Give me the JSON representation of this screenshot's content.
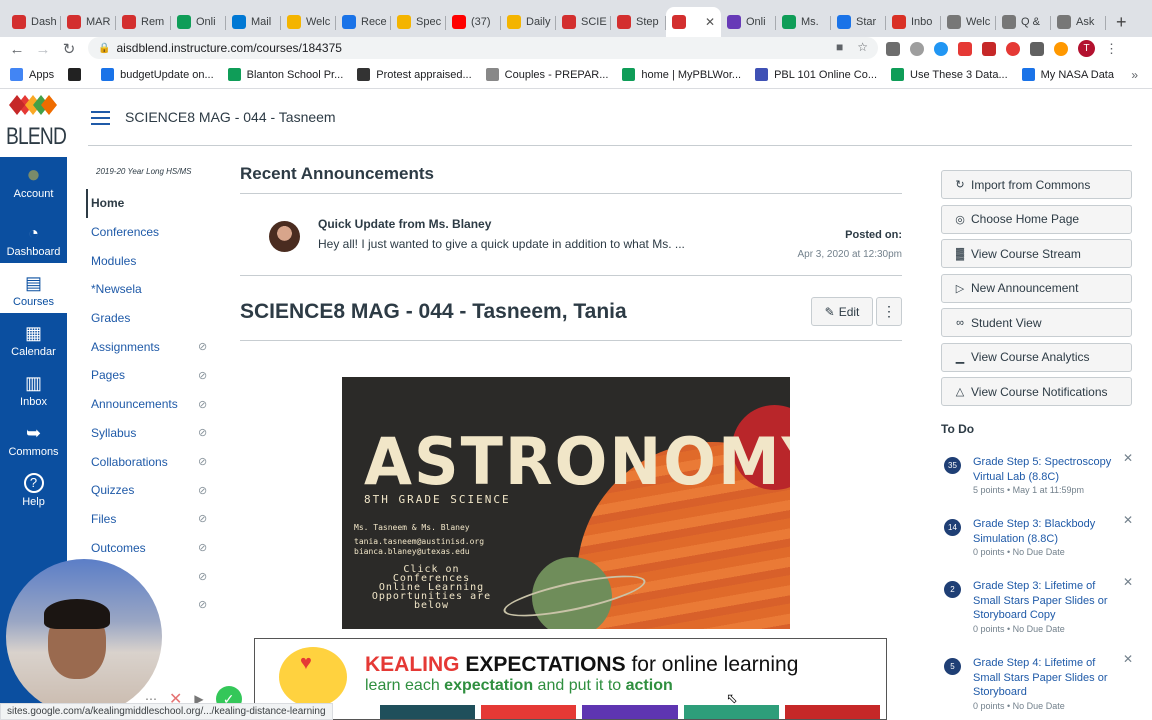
{
  "browser": {
    "tabs": [
      {
        "label": "Dash",
        "color": "#d32f2f"
      },
      {
        "label": "MAR",
        "color": "#d32f2f"
      },
      {
        "label": "Rem",
        "color": "#d32f2f"
      },
      {
        "label": "Onli",
        "color": "#0f9d58"
      },
      {
        "label": "Mail",
        "color": "#0078d4"
      },
      {
        "label": "Welc",
        "color": "#f4b400"
      },
      {
        "label": "Rece",
        "color": "#1a73e8"
      },
      {
        "label": "Spec",
        "color": "#f4b400"
      },
      {
        "label": "(37)",
        "color": "#ff0000"
      },
      {
        "label": "Daily",
        "color": "#f4b400"
      },
      {
        "label": "SCIE",
        "color": "#d32f2f"
      },
      {
        "label": "Step",
        "color": "#d32f2f"
      },
      {
        "label": "",
        "color": "#d32f2f",
        "active": true
      },
      {
        "label": "Onli",
        "color": "#673ab7"
      },
      {
        "label": "Ms.",
        "color": "#0f9d58"
      },
      {
        "label": "Star",
        "color": "#1a73e8"
      },
      {
        "label": "Inbo",
        "color": "#d93025"
      },
      {
        "label": "Welc",
        "color": "#777777"
      },
      {
        "label": "Q &",
        "color": "#777777"
      },
      {
        "label": "Ask",
        "color": "#777777"
      }
    ],
    "url": "aisdblend.instructure.com/courses/184375",
    "profile_initial": "T",
    "bookmarks": [
      {
        "label": "Apps",
        "color": "#4285f4"
      },
      {
        "label": "",
        "color": "#222222"
      },
      {
        "label": "budgetUpdate on...",
        "color": "#1a73e8"
      },
      {
        "label": "Blanton School Pr...",
        "color": "#0f9d58"
      },
      {
        "label": "Protest appraised...",
        "color": "#333333"
      },
      {
        "label": "Couples - PREPAR...",
        "color": "#888888"
      },
      {
        "label": "home | MyPBLWor...",
        "color": "#0f9d58"
      },
      {
        "label": "PBL 101 Online Co...",
        "color": "#3f51b5"
      },
      {
        "label": "Use These 3 Data...",
        "color": "#0f9d58"
      },
      {
        "label": "My NASA Data",
        "color": "#1a73e8"
      }
    ]
  },
  "global_nav": {
    "logo_text": "BLEND",
    "items": [
      {
        "label": "Account",
        "icon": "avatar"
      },
      {
        "label": "Dashboard",
        "icon": "dashboard-icon"
      },
      {
        "label": "Courses",
        "icon": "courses-icon",
        "active": true
      },
      {
        "label": "Calendar",
        "icon": "calendar-icon"
      },
      {
        "label": "Inbox",
        "icon": "inbox-icon"
      },
      {
        "label": "Commons",
        "icon": "commons-icon"
      },
      {
        "label": "Help",
        "icon": "help-icon"
      }
    ]
  },
  "header": {
    "breadcrumb": "SCIENCE8 MAG - 044 - Tasneem"
  },
  "course_nav": {
    "term": "2019-20 Year Long HS/MS",
    "items": [
      {
        "label": "Home",
        "active": true,
        "hidden": false
      },
      {
        "label": "Conferences",
        "hidden": false
      },
      {
        "label": "Modules",
        "hidden": false
      },
      {
        "label": "*Newsela",
        "hidden": false
      },
      {
        "label": "Grades",
        "hidden": false
      },
      {
        "label": "Assignments",
        "hidden": true
      },
      {
        "label": "Pages",
        "hidden": true
      },
      {
        "label": "Announcements",
        "hidden": true
      },
      {
        "label": "Syllabus",
        "hidden": true
      },
      {
        "label": "Collaborations",
        "hidden": true
      },
      {
        "label": "Quizzes",
        "hidden": true
      },
      {
        "label": "Files",
        "hidden": true
      },
      {
        "label": "Outcomes",
        "hidden": true
      },
      {
        "label": "",
        "hidden": true
      },
      {
        "label": "",
        "hidden": true
      }
    ]
  },
  "announcements": {
    "heading": "Recent Announcements",
    "item": {
      "title": "Quick Update from Ms. Blaney",
      "snippet": "Hey all! I just wanted to give a quick update in addition to what Ms. ...",
      "posted_label": "Posted on:",
      "posted_date": "Apr 3, 2020 at 12:30pm"
    }
  },
  "page": {
    "title": "SCIENCE8 MAG - 044 - Tasneem, Tania",
    "edit_label": "Edit",
    "banner": {
      "title": "ASTRONOMY",
      "subtitle": "8TH GRADE SCIENCE",
      "teachers": "Ms. Tasneem & Ms. Blaney",
      "email1": "tania.tasneem@austinisd.org",
      "email2": "bianca.blaney@utexas.edu",
      "conf_line1": "Click on Conferences",
      "conf_line2": "Online Learning",
      "conf_line3": "Opportunities are",
      "conf_line4": "below"
    },
    "kealing": {
      "word1": "KEALING",
      "word2": "EXPECTATIONS",
      "rest": "for online learning",
      "line2_a": "learn each",
      "line2_b": "expectation",
      "line2_c": "and put it to",
      "line2_d": "action",
      "strip_colors": [
        "#1f4f5b",
        "#e53935",
        "#5e35b1",
        "#2e9e7a",
        "#c62828"
      ]
    }
  },
  "sidebar": {
    "buttons": [
      {
        "label": "Import from Commons",
        "icon": "commons-icon"
      },
      {
        "label": "Choose Home Page",
        "icon": "target-icon"
      },
      {
        "label": "View Course Stream",
        "icon": "stream-icon"
      },
      {
        "label": "New Announcement",
        "icon": "megaphone-icon"
      },
      {
        "label": "Student View",
        "icon": "glasses-icon"
      },
      {
        "label": "View Course Analytics",
        "icon": "analytics-icon"
      },
      {
        "label": "View Course Notifications",
        "icon": "bell-icon"
      }
    ],
    "todo_heading": "To Do",
    "todos": [
      {
        "count": "35",
        "title": "Grade Step 5: Spectroscopy Virtual Lab (8.8C)",
        "detail": "5 points • May 1 at 11:59pm"
      },
      {
        "count": "14",
        "title": "Grade Step 3: Blackbody Simulation (8.8C)",
        "detail": "0 points • No Due Date"
      },
      {
        "count": "2",
        "title": "Grade Step 3: Lifetime of Small Stars Paper Slides or Storyboard Copy",
        "detail": "0 points • No Due Date"
      },
      {
        "count": "5",
        "title": "Grade Step 4: Lifetime of Small Stars Paper Slides or Storyboard",
        "detail": "0 points • No Due Date"
      }
    ]
  },
  "status_bar": {
    "url": "sites.google.com/a/kealingmiddleschool.org/.../kealing-distance-learning"
  }
}
